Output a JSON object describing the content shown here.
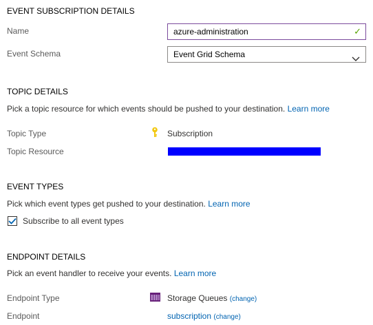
{
  "event_subscription": {
    "heading": "EVENT SUBSCRIPTION DETAILS",
    "name_label": "Name",
    "name_value": "azure-administration",
    "schema_label": "Event Schema",
    "schema_value": "Event Grid Schema"
  },
  "topic": {
    "heading": "TOPIC DETAILS",
    "description": "Pick a topic resource for which events should be pushed to your destination.",
    "learn_more": "Learn more",
    "type_label": "Topic Type",
    "type_value": "Subscription",
    "resource_label": "Topic Resource",
    "resource_redacted_color": "#0000ff"
  },
  "event_types": {
    "heading": "EVENT TYPES",
    "description": "Pick which event types get pushed to your destination.",
    "learn_more": "Learn more",
    "checkbox_label": "Subscribe to all event types",
    "checked": true
  },
  "endpoint": {
    "heading": "ENDPOINT DETAILS",
    "description": "Pick an event handler to receive your events.",
    "learn_more": "Learn more",
    "type_label": "Endpoint Type",
    "type_value": "Storage Queues",
    "type_change": "(change)",
    "endpoint_label": "Endpoint",
    "endpoint_value": "subscription",
    "endpoint_change": "(change)"
  },
  "icons": {
    "valid": "checkmark-icon",
    "dropdown": "chevron-down-icon",
    "subscription": "key-icon",
    "storage": "storage-queue-icon",
    "checkbox": "checkbox-checked-icon"
  },
  "colors": {
    "link": "#0063b1",
    "valid_check": "#57a300",
    "key_icon": "#f2c811",
    "storage_icon": "#68217a",
    "active_border": "#7a4a9c"
  }
}
